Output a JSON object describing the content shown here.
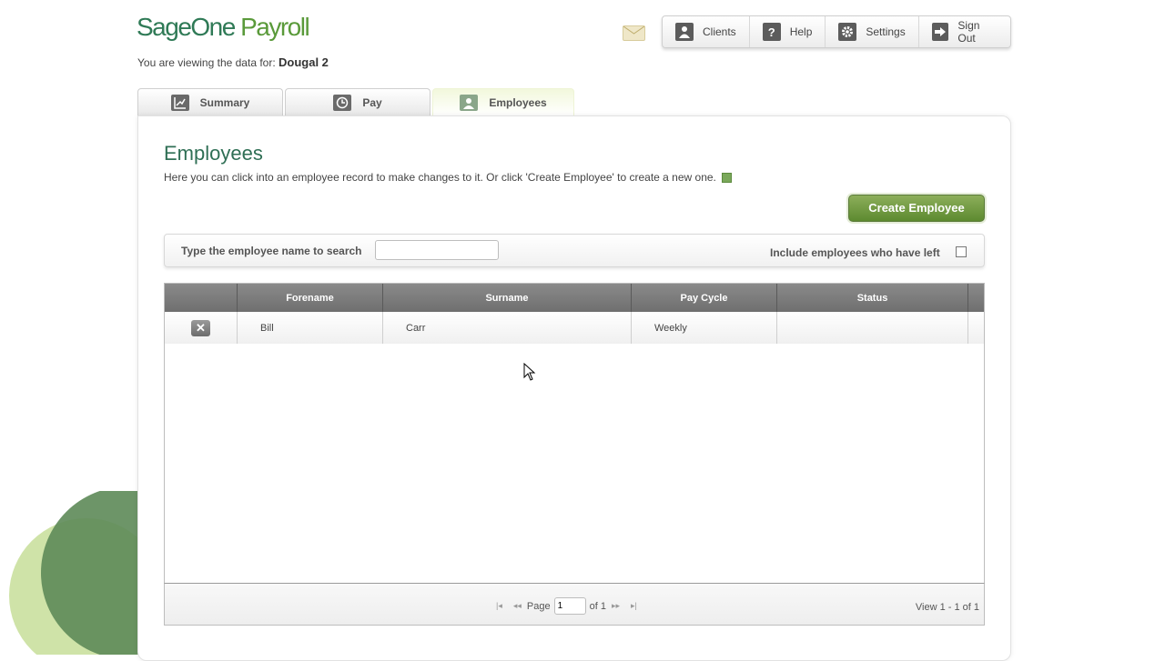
{
  "app": {
    "logo_sage": "SageOne",
    "logo_payroll": " Payroll",
    "viewing_prefix": "You are viewing the data for:",
    "client_name": "Dougal 2"
  },
  "topnav": {
    "mail_icon": "envelope-icon",
    "items": [
      {
        "label": "Clients",
        "icon": "person-icon"
      },
      {
        "label": "Help",
        "icon": "question-icon"
      },
      {
        "label": "Settings",
        "icon": "gear-icon"
      },
      {
        "label": "Sign Out",
        "icon": "exit-arrow-icon"
      }
    ]
  },
  "tabs": [
    {
      "label": "Summary",
      "icon": "chart-icon",
      "active": false
    },
    {
      "label": "Pay",
      "icon": "clock-icon",
      "active": false
    },
    {
      "label": "Employees",
      "icon": "people-icon",
      "active": true
    }
  ],
  "main": {
    "title": "Employees",
    "intro": "Here you can click into an employee record to make changes to it. Or click 'Create Employee' to create a new one.",
    "create_button": "Create Employee"
  },
  "search": {
    "label": "Type the employee name to search",
    "value": "",
    "include_left_label": "Include employees who have left",
    "include_left_checked": false
  },
  "table": {
    "headers": [
      "",
      "Forename",
      "Surname",
      "Pay Cycle",
      "Status"
    ],
    "rows": [
      {
        "forename": "Bill",
        "surname": "Carr",
        "pay_cycle": "Weekly",
        "status": ""
      }
    ]
  },
  "pager": {
    "page_label": "Page",
    "page_value": "1",
    "of_label": "of 1",
    "view_text": "View 1 - 1 of 1"
  },
  "colors": {
    "brand_green": "#2f7a56",
    "button_green": "#5d8a30"
  }
}
